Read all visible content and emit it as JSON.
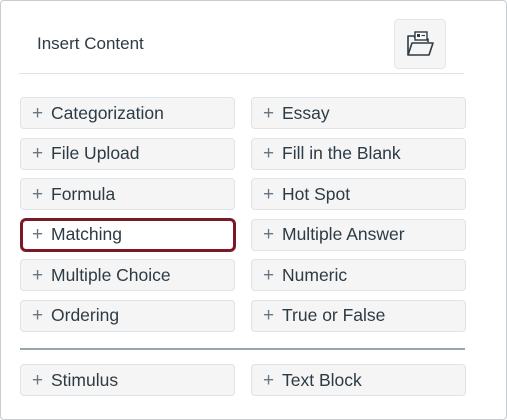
{
  "header": {
    "title": "Insert Content",
    "bank_icon": "item-bank-folder-icon"
  },
  "items": [
    {
      "label": "Categorization",
      "name": "categorization"
    },
    {
      "label": "Essay",
      "name": "essay"
    },
    {
      "label": "File Upload",
      "name": "file-upload"
    },
    {
      "label": "Fill in the Blank",
      "name": "fill-in-the-blank"
    },
    {
      "label": "Formula",
      "name": "formula"
    },
    {
      "label": "Hot Spot",
      "name": "hot-spot"
    },
    {
      "label": "Matching",
      "name": "matching",
      "selected": true
    },
    {
      "label": "Multiple Answer",
      "name": "multiple-answer"
    },
    {
      "label": "Multiple Choice",
      "name": "multiple-choice"
    },
    {
      "label": "Numeric",
      "name": "numeric"
    },
    {
      "label": "Ordering",
      "name": "ordering"
    },
    {
      "label": "True or False",
      "name": "true-or-false"
    }
  ],
  "extras": [
    {
      "label": "Stimulus",
      "name": "stimulus"
    },
    {
      "label": "Text Block",
      "name": "text-block"
    }
  ],
  "plus_glyph": "+",
  "colors": {
    "selected_border": "#7a1a26",
    "text": "#2d3b45",
    "button_bg": "#f5f5f5"
  }
}
